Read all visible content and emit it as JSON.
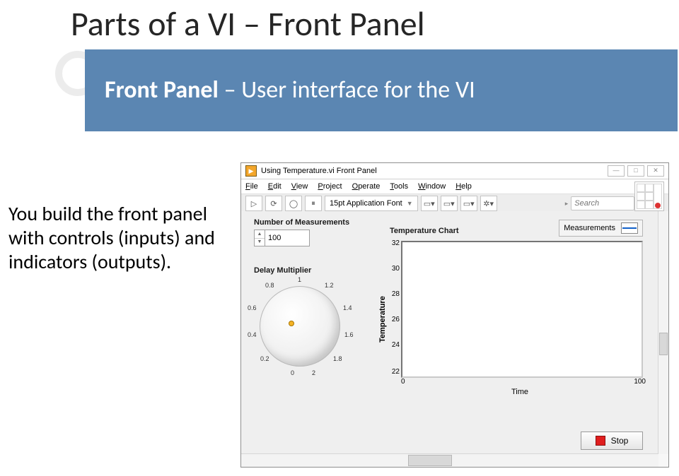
{
  "title": "Parts of a VI – Front Panel",
  "banner": {
    "bold": "Front Panel",
    "rest": " – User interface for the VI"
  },
  "body": "You build the front panel with controls (inputs) and indicators (outputs).",
  "win": {
    "title": "Using Temperature.vi Front Panel",
    "buttons": {
      "min": "—",
      "max": "□",
      "close": "✕"
    },
    "menu": [
      "File",
      "Edit",
      "View",
      "Project",
      "Operate",
      "Tools",
      "Window",
      "Help"
    ],
    "toolbar": {
      "run": "▷",
      "runcont": "⟳",
      "abort": "◯",
      "pause": "⏸",
      "font": "15pt Application Font",
      "align": "▭▾",
      "dist": "▭▾",
      "resize": "▭▾",
      "reorder": "✲▾",
      "search_placeholder": "Search",
      "mag": "🔍",
      "help": "?"
    },
    "fp": {
      "num_label": "Number of Measurements",
      "num_value": "100",
      "delay_label": "Delay Multiplier",
      "dial_ticks": {
        "t0": "0",
        "t02": "0.2",
        "t04": "0.4",
        "t06": "0.6",
        "t08": "0.8",
        "t1": "1",
        "t12": "1.2",
        "t14": "1.4",
        "t16": "1.6",
        "t18": "1.8",
        "t2": "2"
      },
      "chart_label": "Temperature Chart",
      "ylabel": "Temperature",
      "xlabel": "Time",
      "legend": "Measurements",
      "stop": "Stop"
    }
  },
  "chart_data": {
    "type": "line",
    "title": "Temperature Chart",
    "xlabel": "Time",
    "ylabel": "Temperature",
    "x": [
      0,
      100
    ],
    "xlim": [
      0,
      100
    ],
    "ylim": [
      22,
      32
    ],
    "yticks": [
      22,
      24,
      26,
      28,
      30,
      32
    ],
    "series": [
      {
        "name": "Measurements",
        "values": []
      }
    ]
  }
}
